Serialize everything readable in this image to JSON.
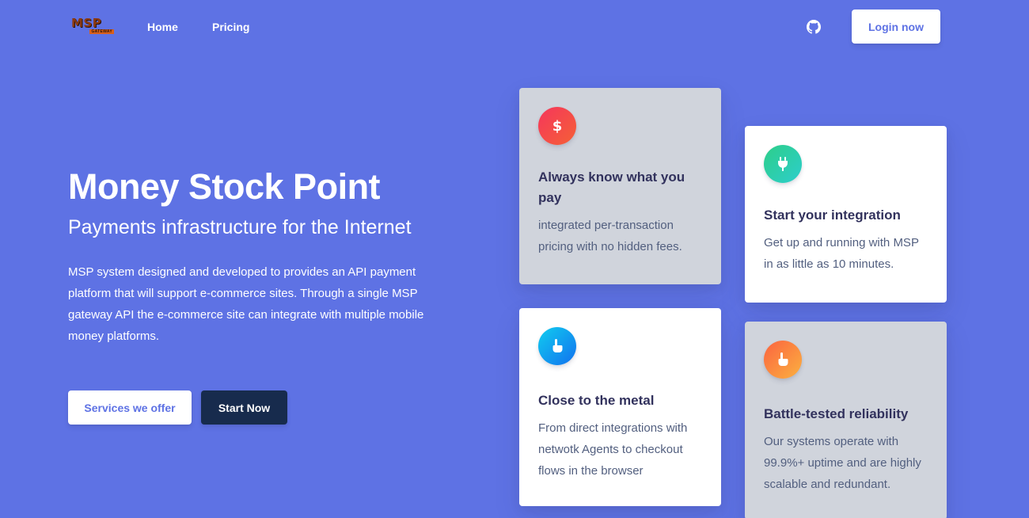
{
  "nav": {
    "logo_text": "MSP",
    "logo_subtext": "GATEWAY",
    "home": "Home",
    "pricing": "Pricing",
    "github_icon": "github-icon",
    "login": "Login now"
  },
  "hero": {
    "title": "Money Stock Point",
    "subtitle": "Payments infrastructure for the Internet",
    "description": "MSP system designed and developed to provides an API payment platform that will support e-commerce sites. Through a single MSP gateway API the e-commerce site can integrate with multiple mobile money platforms.",
    "services_button": "Services we offer",
    "start_button": "Start Now"
  },
  "cards": [
    {
      "icon": "dollar-icon",
      "title": "Always know what you pay",
      "text": "integrated per-transaction pricing with no hidden fees.",
      "color": "#f5365c"
    },
    {
      "icon": "plug-icon",
      "title": "Start your integration",
      "text": "Get up and running with MSP in as little as 10 minutes.",
      "color": "#2dce89"
    },
    {
      "icon": "hand-pointer-icon",
      "title": "Close to the metal",
      "text": "From direct integrations with netwotk Agents to checkout flows in the browser",
      "color": "#11cdef"
    },
    {
      "icon": "hand-pointer-icon",
      "title": "Battle-tested reliability",
      "text": "Our systems operate with 99.9%+ uptime and are highly scalable and redundant.",
      "color": "#fb6340"
    }
  ],
  "colors": {
    "background": "#5e72e4",
    "primary": "#5e72e4",
    "dark": "#172b4d",
    "card_gray": "#d0d4dc"
  }
}
